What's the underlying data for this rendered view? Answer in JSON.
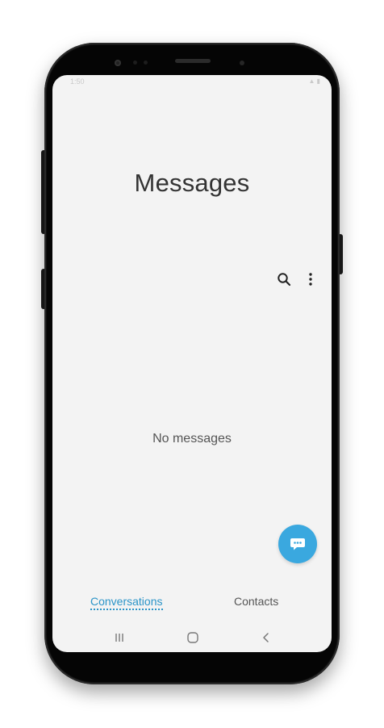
{
  "status_bar": {
    "time": "1:50",
    "icons": "▲ ▮"
  },
  "app": {
    "title": "Messages"
  },
  "toolbar": {
    "search_icon": "search-icon",
    "more_icon": "more-vertical-icon"
  },
  "conversations": {
    "empty_text": "No messages"
  },
  "fab": {
    "icon": "compose-message-icon",
    "color": "#3aa8df"
  },
  "tabs": [
    {
      "label": "Conversations",
      "active": true
    },
    {
      "label": "Contacts",
      "active": false
    }
  ],
  "colors": {
    "accent": "#2b94c8",
    "screen_background": "#f3f3f3"
  }
}
